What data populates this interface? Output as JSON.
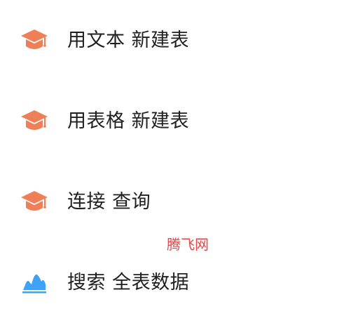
{
  "menu": {
    "items": [
      {
        "label": "用文本 新建表",
        "icon": "graduation-cap-icon",
        "icon_color": "#ee7f57"
      },
      {
        "label": "用表格 新建表",
        "icon": "graduation-cap-icon",
        "icon_color": "#ee7f57"
      },
      {
        "label": "连接 查询",
        "icon": "graduation-cap-icon",
        "icon_color": "#ee7f57"
      },
      {
        "label": "搜索 全表数据",
        "icon": "mountain-chart-icon",
        "icon_color": "#3fa2f7"
      }
    ]
  },
  "watermark": {
    "text": "腾飞网",
    "color": "#e0474c"
  }
}
